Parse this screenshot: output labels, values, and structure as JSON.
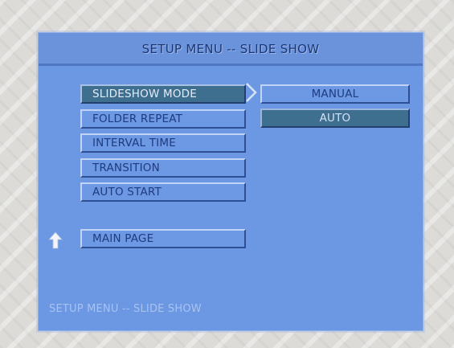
{
  "header": {
    "title": "SETUP MENU -- SLIDE SHOW"
  },
  "menu": {
    "items": [
      {
        "label": "SLIDESHOW MODE",
        "selected": true
      },
      {
        "label": "FOLDER REPEAT"
      },
      {
        "label": "INTERVAL TIME"
      },
      {
        "label": "TRANSITION"
      },
      {
        "label": "AUTO START"
      }
    ],
    "main_page_label": "MAIN PAGE",
    "main_page_icon": "up-arrow-icon"
  },
  "options": {
    "items": [
      {
        "label": "MANUAL"
      },
      {
        "label": "AUTO",
        "active": true
      }
    ]
  },
  "footer": {
    "status_text": "SETUP MENU -- SLIDE SHOW"
  },
  "colors": {
    "screen_bg": "#6c97e2",
    "title_text": "#1b3674",
    "selected_bg": "#3f6f8f",
    "footer_text": "#a9c3ef"
  }
}
